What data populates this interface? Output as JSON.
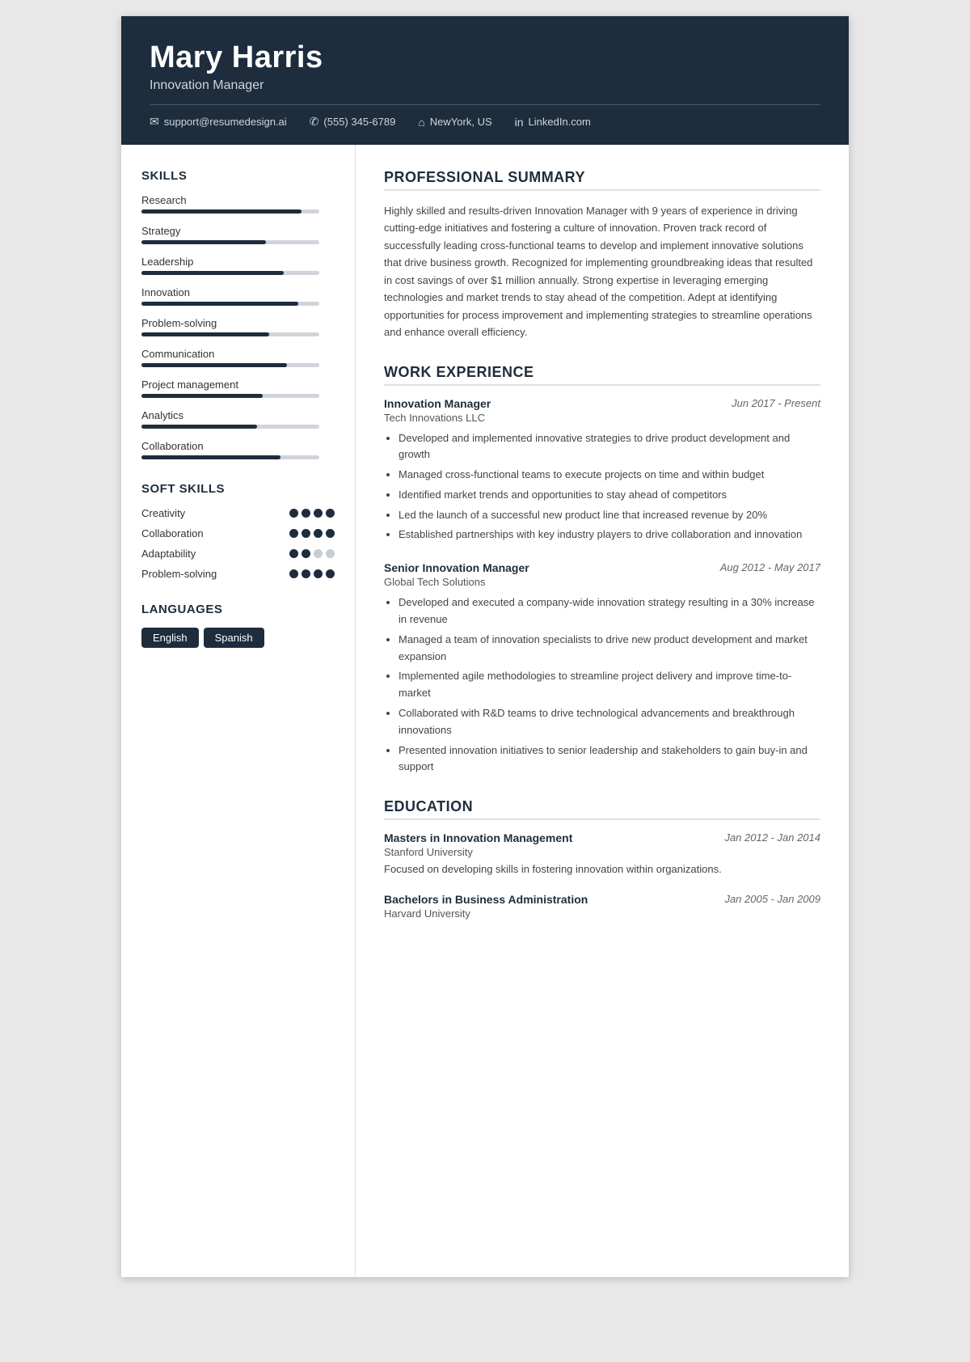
{
  "header": {
    "name": "Mary Harris",
    "title": "Innovation Manager",
    "contact": {
      "email": "support@resumedesign.ai",
      "phone": "(555) 345-6789",
      "location": "NewYork, US",
      "linkedin": "LinkedIn.com"
    }
  },
  "sidebar": {
    "skills_title": "SKILLS",
    "skills": [
      {
        "name": "Research",
        "percent": 90
      },
      {
        "name": "Strategy",
        "percent": 70
      },
      {
        "name": "Leadership",
        "percent": 80
      },
      {
        "name": "Innovation",
        "percent": 88
      },
      {
        "name": "Problem-solving",
        "percent": 72
      },
      {
        "name": "Communication",
        "percent": 82
      },
      {
        "name": "Project management",
        "percent": 68
      },
      {
        "name": "Analytics",
        "percent": 65
      },
      {
        "name": "Collaboration",
        "percent": 78
      }
    ],
    "soft_skills_title": "SOFT SKILLS",
    "soft_skills": [
      {
        "name": "Creativity",
        "filled": 4,
        "total": 4
      },
      {
        "name": "Collaboration",
        "filled": 4,
        "total": 4
      },
      {
        "name": "Adaptability",
        "filled": 2,
        "total": 4
      },
      {
        "name": "Problem-solving",
        "filled": 4,
        "total": 4
      }
    ],
    "languages_title": "LANGUAGES",
    "languages": [
      "English",
      "Spanish"
    ]
  },
  "main": {
    "summary_title": "PROFESSIONAL SUMMARY",
    "summary": "Highly skilled and results-driven Innovation Manager with 9 years of experience in driving cutting-edge initiatives and fostering a culture of innovation. Proven track record of successfully leading cross-functional teams to develop and implement innovative solutions that drive business growth. Recognized for implementing groundbreaking ideas that resulted in cost savings of over $1 million annually. Strong expertise in leveraging emerging technologies and market trends to stay ahead of the competition. Adept at identifying opportunities for process improvement and implementing strategies to streamline operations and enhance overall efficiency.",
    "work_title": "WORK EXPERIENCE",
    "jobs": [
      {
        "title": "Innovation Manager",
        "company": "Tech Innovations LLC",
        "date": "Jun 2017 - Present",
        "bullets": [
          "Developed and implemented innovative strategies to drive product development and growth",
          "Managed cross-functional teams to execute projects on time and within budget",
          "Identified market trends and opportunities to stay ahead of competitors",
          "Led the launch of a successful new product line that increased revenue by 20%",
          "Established partnerships with key industry players to drive collaboration and innovation"
        ]
      },
      {
        "title": "Senior Innovation Manager",
        "company": "Global Tech Solutions",
        "date": "Aug 2012 - May 2017",
        "bullets": [
          "Developed and executed a company-wide innovation strategy resulting in a 30% increase in revenue",
          "Managed a team of innovation specialists to drive new product development and market expansion",
          "Implemented agile methodologies to streamline project delivery and improve time-to-market",
          "Collaborated with R&D teams to drive technological advancements and breakthrough innovations",
          "Presented innovation initiatives to senior leadership and stakeholders to gain buy-in and support"
        ]
      }
    ],
    "education_title": "EDUCATION",
    "education": [
      {
        "degree": "Masters in Innovation Management",
        "school": "Stanford University",
        "date": "Jan 2012 - Jan 2014",
        "desc": "Focused on developing skills in fostering innovation within organizations."
      },
      {
        "degree": "Bachelors in Business Administration",
        "school": "Harvard University",
        "date": "Jan 2005 - Jan 2009",
        "desc": ""
      }
    ]
  }
}
